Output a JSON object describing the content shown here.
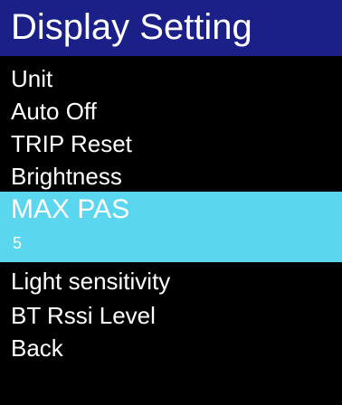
{
  "colors": {
    "background": "#000000",
    "header_background": "#1b1f88",
    "text": "#ffffff",
    "selected_background": "#5ad6ee"
  },
  "header": {
    "title": "Display Setting"
  },
  "menu": {
    "items": [
      {
        "label": "Unit"
      },
      {
        "label": "Auto Off"
      },
      {
        "label": "TRIP Reset"
      },
      {
        "label": "Brightness"
      },
      {
        "label": "MAX PAS",
        "value": "5",
        "selected": true
      },
      {
        "label": "Light sensitivity"
      },
      {
        "label": "BT Rssi Level"
      },
      {
        "label": "Back"
      }
    ]
  }
}
